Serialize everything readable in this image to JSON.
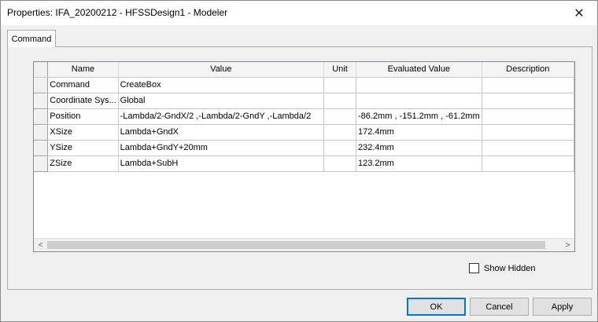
{
  "window": {
    "title": "Properties: IFA_20200212 - HFSSDesign1 - Modeler",
    "close_symbol": "✕"
  },
  "tabs": [
    {
      "label": "Command",
      "selected": true
    }
  ],
  "table": {
    "columns": [
      "Name",
      "Value",
      "Unit",
      "Evaluated Value",
      "Description"
    ],
    "rows": [
      {
        "name": "Command",
        "value": "CreateBox",
        "unit": "",
        "evaluated": "",
        "description": ""
      },
      {
        "name": "Coordinate Sys...",
        "value": "Global",
        "unit": "",
        "evaluated": "",
        "description": ""
      },
      {
        "name": "Position",
        "value": "-Lambda/2-GndX/2 ,-Lambda/2-GndY ,-Lambda/2",
        "unit": "",
        "evaluated": "-86.2mm , -151.2mm , -61.2mm",
        "description": ""
      },
      {
        "name": "XSize",
        "value": "Lambda+GndX",
        "unit": "",
        "evaluated": "172.4mm",
        "description": ""
      },
      {
        "name": "YSize",
        "value": "Lambda+GndY+20mm",
        "unit": "",
        "evaluated": "232.4mm",
        "description": ""
      },
      {
        "name": "ZSize",
        "value": "Lambda+SubH",
        "unit": "",
        "evaluated": "123.2mm",
        "description": ""
      }
    ]
  },
  "scrollbar": {
    "left_arrow": "<",
    "right_arrow": ">"
  },
  "show_hidden": {
    "label": "Show Hidden",
    "checked": false
  },
  "buttons": {
    "ok": "OK",
    "cancel": "Cancel",
    "apply": "Apply"
  }
}
